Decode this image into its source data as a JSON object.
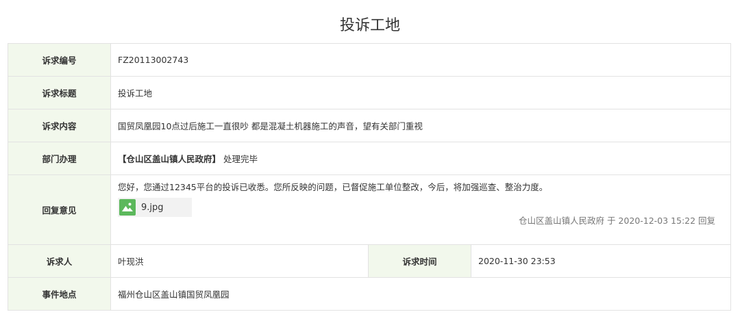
{
  "page": {
    "title": "投诉工地"
  },
  "fields": {
    "id_label": "诉求编号",
    "id_value": "FZ20113002743",
    "title_label": "诉求标题",
    "title_value": "投诉工地",
    "content_label": "诉求内容",
    "content_value": "国贸凤凰园10点过后施工一直很吵 都是混凝土机器施工的声音，望有关部门重视",
    "dept_label": "部门办理",
    "dept_name": "【仓山区盖山镇人民政府】",
    "dept_status": "处理完毕",
    "reply_label": "回复意见",
    "reply_text": "您好，您通过12345平台的投诉已收悉。您所反映的问题，已督促施工单位整改，今后，将加强巡查、整治力度。",
    "attachment_name": "9.jpg",
    "reply_meta": "仓山区盖山镇人民政府 于 2020-12-03 15:22 回复",
    "person_label": "诉求人",
    "person_value": "叶现洪",
    "time_label": "诉求时间",
    "time_value": "2020-11-30 23:53",
    "location_label": "事件地点",
    "location_value": "福州仓山区盖山镇国贸凤凰园"
  },
  "colors": {
    "label_bg": "#f2f8ec",
    "label_text": "#6aa834",
    "icon_green": "#5cb85c"
  },
  "icons": {
    "attachment": "image-icon"
  }
}
